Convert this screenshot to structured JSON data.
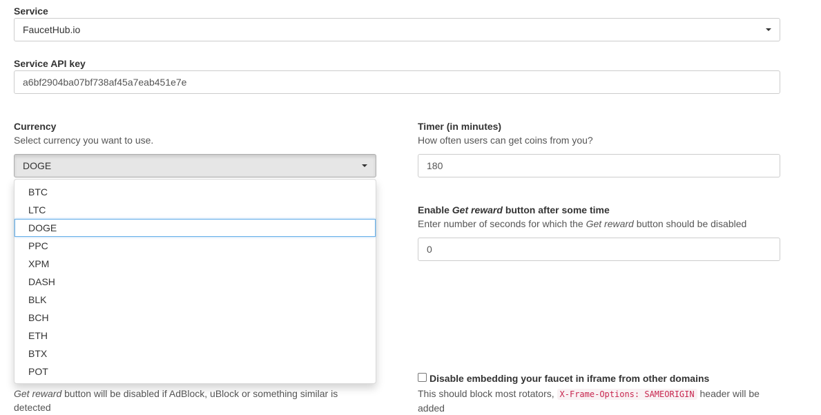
{
  "service": {
    "label": "Service",
    "selected": "FaucetHub.io"
  },
  "api_key": {
    "label": "Service API key",
    "value": "a6bf2904ba07bf738af45a7eab451e7e"
  },
  "currency": {
    "label": "Currency",
    "help": "Select currency you want to use.",
    "selected": "DOGE",
    "options": [
      "BTC",
      "LTC",
      "DOGE",
      "PPC",
      "XPM",
      "DASH",
      "BLK",
      "BCH",
      "ETH",
      "BTX",
      "POT"
    ]
  },
  "timer": {
    "label": "Timer (in minutes)",
    "help": "How often users can get coins from you?",
    "value": "180"
  },
  "reward_delay": {
    "label_prefix": "Enable ",
    "label_em": "Get reward",
    "label_suffix": " button after some time",
    "help_prefix": "Enter number of seconds for which the ",
    "help_em": "Get reward",
    "help_suffix": " button should be disabled",
    "value": "0"
  },
  "adblock": {
    "help_em": "Get reward",
    "help_rest": " button will be disabled if AdBlock, uBlock or something similar is",
    "help_line2": "detected"
  },
  "iframe": {
    "label": "Disable embedding your faucet in iframe from other domains",
    "help_prefix": "This should block most rotators, ",
    "code": "X-Frame-Options: SAMEORIGIN",
    "help_suffix": " header will be",
    "help_line2": "added",
    "checked": false
  }
}
